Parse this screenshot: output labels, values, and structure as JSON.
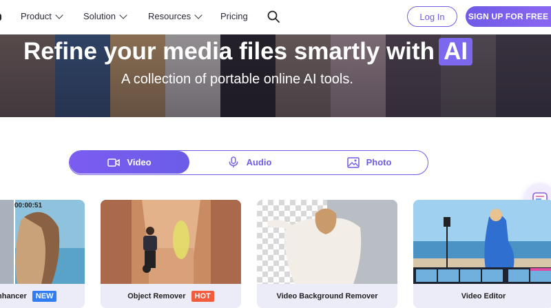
{
  "nav": {
    "items": [
      {
        "label": "Product",
        "has_dropdown": true
      },
      {
        "label": "Solution",
        "has_dropdown": true
      },
      {
        "label": "Resources",
        "has_dropdown": true
      },
      {
        "label": "Pricing",
        "has_dropdown": false
      }
    ],
    "search_icon": "search-icon",
    "login_label": "Log In",
    "signup_label": "SIGN UP FOR FREE"
  },
  "hero": {
    "title": "Refine your media files smartly with",
    "title_badge": "AI",
    "subtitle": "A collection of portable online AI tools."
  },
  "tabs": [
    {
      "label": "Video",
      "icon": "video-icon",
      "active": true
    },
    {
      "label": "Audio",
      "icon": "microphone-icon",
      "active": false
    },
    {
      "label": "Photo",
      "icon": "image-icon",
      "active": false
    }
  ],
  "cards": [
    {
      "title": "nhancer",
      "badge": "NEW",
      "timecode": "00:00:51"
    },
    {
      "title": "Object Remover",
      "badge": "HOT"
    },
    {
      "title": "Video Background Remover",
      "badge": ""
    },
    {
      "title": "Video Editor",
      "badge": ""
    }
  ],
  "colors": {
    "accent": "#6d5ce8",
    "new_badge": "#2f7cf6",
    "hot_badge": "#f25c3c",
    "card_footer": "#ecebf8"
  }
}
